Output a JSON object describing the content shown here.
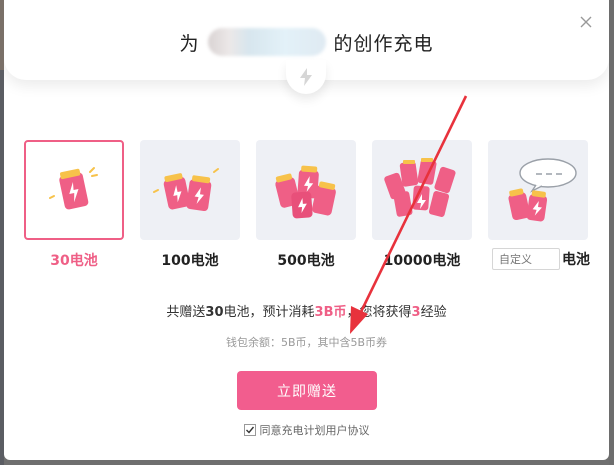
{
  "title": {
    "prefix": "为",
    "suffix": "的创作充电"
  },
  "options": [
    {
      "label": "30电池",
      "selected": true
    },
    {
      "label": "100电池",
      "selected": false
    },
    {
      "label": "500电池",
      "selected": false
    },
    {
      "label": "10000电池",
      "selected": false
    }
  ],
  "custom": {
    "placeholder": "自定义",
    "unit": "电池"
  },
  "summary": {
    "part1": "共赠送",
    "amount": "30",
    "part2": "电池，预计消耗",
    "cost": "3B币",
    "part3": "，您将获得",
    "exp": "3",
    "part4": "经验"
  },
  "wallet": "钱包余额：5B币，其中含5B币券",
  "send_button": "立即赠送",
  "agreement": {
    "checked": true,
    "label": "同意充电计划用户协议"
  },
  "colors": {
    "accent": "#f25d8e",
    "selected_border": "#ef5f86",
    "annotation_arrow": "#e8323c"
  },
  "icons": {
    "close": "close-icon",
    "bolt": "lightning-bolt-icon",
    "battery": "battery-icon",
    "speech_bubble": "speech-bubble-icon",
    "check": "checkmark-icon"
  }
}
